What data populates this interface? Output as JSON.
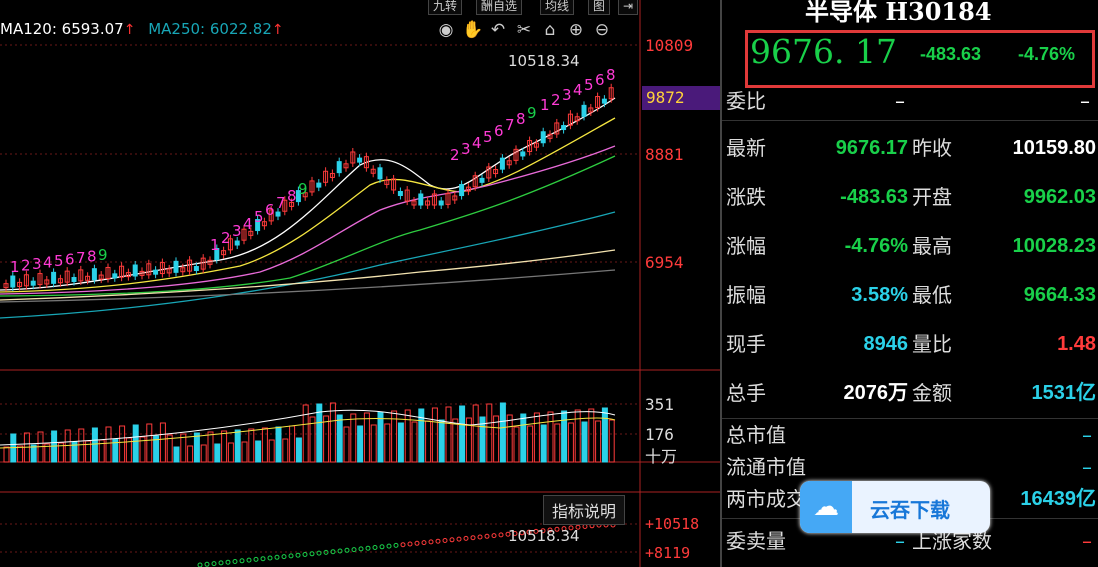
{
  "chart": {
    "ma120_label": "MA120: 6593.07",
    "ma250_label": "MA250: 6022.82",
    "up_arrow": "↑",
    "toolbar_tabs": [
      "九转",
      "酬自选",
      "均线",
      "图"
    ],
    "tool_icons": [
      "eye-icon",
      "hand-icon",
      "undo-icon",
      "scissors-icon",
      "lock-icon",
      "zoom-in-icon",
      "zoom-out-icon"
    ],
    "tool_glyphs": [
      "◉",
      "✋",
      "↶",
      "✂",
      "🔒",
      "⊕",
      "⊖"
    ],
    "price_axis": [
      "10809",
      "8881",
      "6954"
    ],
    "current_price_tag": "9872",
    "peak_label": "10518.34",
    "volume_axis": [
      "351",
      "176",
      "十万"
    ],
    "indicator_axis": [
      "+10518",
      "+8119"
    ],
    "indicator_button": "指标说明",
    "indicator_peak": "10518.34",
    "nine_turn_left": [
      "1",
      "2",
      "3",
      "4",
      "5",
      "6",
      "7",
      "8",
      "9"
    ],
    "nine_turn_mid": [
      "1",
      "2",
      "3",
      "4",
      "5",
      "6",
      "7",
      "8",
      "9"
    ],
    "nine_turn_right": [
      "2",
      "3",
      "4",
      "5",
      "6",
      "7",
      "8",
      "9"
    ],
    "nine_turn_top": [
      "1",
      "2",
      "3",
      "4",
      "5",
      "6",
      "8"
    ]
  },
  "panel": {
    "title": "半导体 H30184",
    "price": "9676. 17",
    "change": "-483.63",
    "change_pct": "-4.76%",
    "weibi_label": "委比",
    "weibi_value": "–",
    "weibi_value2": "–",
    "rows": [
      {
        "l1": "最新",
        "v1": "9676.17",
        "c1": "green",
        "l2": "昨收",
        "v2": "10159.80",
        "c2": "white"
      },
      {
        "l1": "涨跌",
        "v1": "-483.63",
        "c1": "green",
        "l2": "开盘",
        "v2": "9962.03",
        "c2": "green"
      },
      {
        "l1": "涨幅",
        "v1": "-4.76%",
        "c1": "green",
        "l2": "最高",
        "v2": "10028.23",
        "c2": "green"
      },
      {
        "l1": "振幅",
        "v1": "3.58%",
        "c1": "cyan",
        "l2": "最低",
        "v2": "9664.33",
        "c2": "green"
      },
      {
        "l1": "现手",
        "v1": "8946",
        "c1": "cyan",
        "l2": "量比",
        "v2": "1.48",
        "c2": "red"
      },
      {
        "l1": "总手",
        "v1": "2076万",
        "c1": "white",
        "l2": "金额",
        "v2": "1531亿",
        "c2": "cyan"
      }
    ],
    "zongshizhi_label": "总市值",
    "zongshizhi_value": "–",
    "liutong_label": "流通市值",
    "liutong_value": "–",
    "liangshi_label": "两市成交",
    "liangshi_value": "16439亿",
    "weimai_label": "委卖量",
    "weimai_value": "–",
    "shangzhang_label": "上涨家数",
    "shangzhang_value": "–",
    "download_label": "云吞下载"
  },
  "colors": {
    "up": "#ff3b3b",
    "down": "#19d04a",
    "cyan": "#2bd1e8",
    "ma_white": "#ffffff",
    "ma_yellow": "#f5e640",
    "ma_pink": "#e86ad8",
    "ma_green": "#2ecc40",
    "ma_blue": "#18a6b6",
    "ma_cream": "#f3e3b0",
    "nine_turn": "#ff3bd6",
    "nine_turn_final": "#19d04a"
  }
}
